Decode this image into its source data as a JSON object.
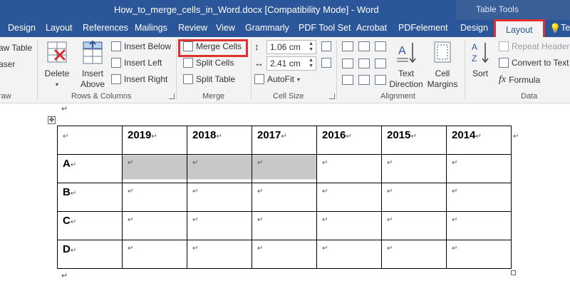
{
  "window": {
    "title": "How_to_merge_cells_in_Word.docx [Compatibility Mode] - Word",
    "context_label": "Table Tools"
  },
  "tabs": [
    "Design",
    "Layout",
    "References",
    "Mailings",
    "Review",
    "View",
    "Grammarly",
    "PDF Tool Set",
    "Acrobat",
    "PDFelement",
    "Design",
    "Layout"
  ],
  "tell_me_partial": "Te",
  "ribbon": {
    "draw": {
      "draw_table": "aw Table",
      "eraser": "aser",
      "label": "raw"
    },
    "rows_columns": {
      "delete": "Delete",
      "insert_above_line1": "Insert",
      "insert_above_line2": "Above",
      "insert_below": "Insert Below",
      "insert_left": "Insert Left",
      "insert_right": "Insert Right",
      "label": "Rows & Columns"
    },
    "merge": {
      "merge_cells": "Merge Cells",
      "split_cells": "Split Cells",
      "split_table": "Split Table",
      "label": "Merge"
    },
    "cell_size": {
      "height": "1.06 cm",
      "width": "2.41 cm",
      "autofit": "AutoFit",
      "label": "Cell Size"
    },
    "alignment": {
      "text_direction_line1": "Text",
      "text_direction_line2": "Direction",
      "cell_margins_line1": "Cell",
      "cell_margins_line2": "Margins",
      "label": "Alignment"
    },
    "data": {
      "sort": "Sort",
      "repeat_header": "Repeat Header R",
      "convert_to_text": "Convert to Text",
      "formula": "Formula",
      "label": "Data"
    }
  },
  "document": {
    "paragraph_mark": "↵",
    "header_row": [
      "",
      "2019",
      "2018",
      "2017",
      "2016",
      "2015",
      "2014"
    ],
    "rows": [
      {
        "label": "A",
        "selected": [
          true,
          true,
          true,
          false,
          false,
          false
        ]
      },
      {
        "label": "B",
        "selected": [
          false,
          false,
          false,
          false,
          false,
          false
        ]
      },
      {
        "label": "C",
        "selected": [
          false,
          false,
          false,
          false,
          false,
          false
        ]
      },
      {
        "label": "D",
        "selected": [
          false,
          false,
          false,
          false,
          false,
          false
        ]
      }
    ]
  },
  "colors": {
    "title_bar": "#2b579a",
    "highlight": "#e0312f",
    "selection": "#c8c8c8"
  }
}
